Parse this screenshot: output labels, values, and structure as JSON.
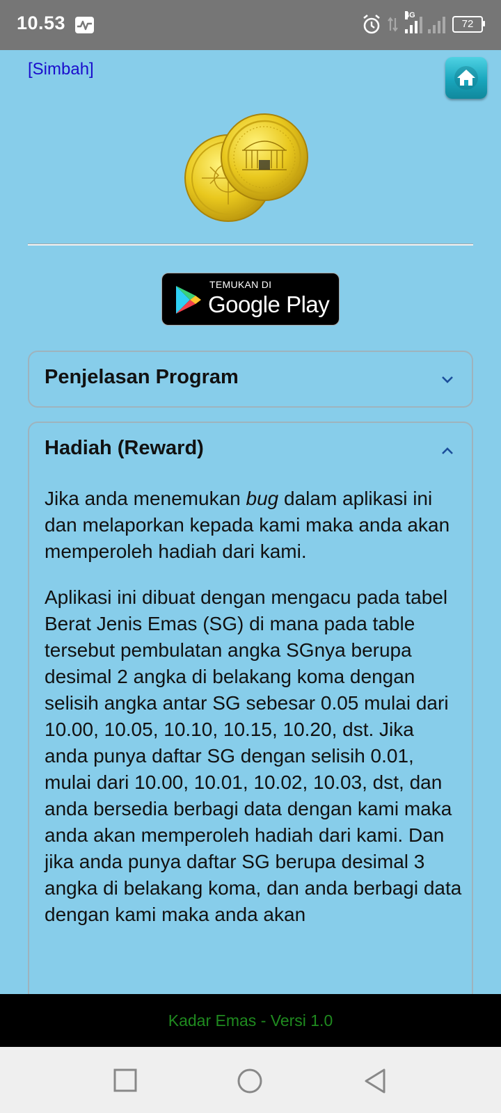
{
  "status_bar": {
    "time": "10.53",
    "network": "4G",
    "battery": "72",
    "icons": [
      "activity-icon",
      "alarm-icon",
      "data-arrows-icon",
      "signal-icon",
      "signal-icon-2",
      "battery-icon"
    ]
  },
  "header": {
    "link": "[Simbah]",
    "home_icon": "home-icon"
  },
  "logo": {
    "icon": "gold-coins-logo"
  },
  "play_badge": {
    "small": "TEMUKAN DI",
    "big": "Google Play"
  },
  "accordions": [
    {
      "title": "Penjelasan Program",
      "expanded": false,
      "icon": "chevron-down-icon"
    },
    {
      "title": "Hadiah (Reward)",
      "expanded": true,
      "icon": "chevron-up-icon",
      "p1_before": "Jika anda menemukan ",
      "p1_em": "bug",
      "p1_after": " dalam aplikasi ini dan melaporkan kepada kami maka anda akan memperoleh hadiah dari kami.",
      "p2": "Aplikasi ini dibuat dengan mengacu pada tabel Berat Jenis Emas (SG) di mana pada table tersebut pembulatan angka SGnya berupa desimal 2 angka di belakang koma dengan selisih angka antar SG sebesar 0.05 mulai dari 10.00, 10.05, 10.10, 10.15, 10.20, dst. Jika anda punya daftar SG dengan selisih 0.01, mulai dari 10.00, 10.01, 10.02, 10.03, dst, dan anda bersedia berbagi data dengan kami maka anda akan memperoleh hadiah dari kami. Dan jika anda punya daftar SG berupa desimal 3 angka di belakang koma, dan anda berbagi data dengan kami maka anda akan"
    }
  ],
  "footer": {
    "text": "Kadar Emas - Versi 1.0"
  },
  "nav": {
    "icons": [
      "recents-square-icon",
      "home-circle-icon",
      "back-triangle-icon"
    ]
  },
  "colors": {
    "background": "#87cdea",
    "link": "#1a0dcc",
    "footer_text": "#1f8a1f",
    "status_bar": "#767676"
  }
}
